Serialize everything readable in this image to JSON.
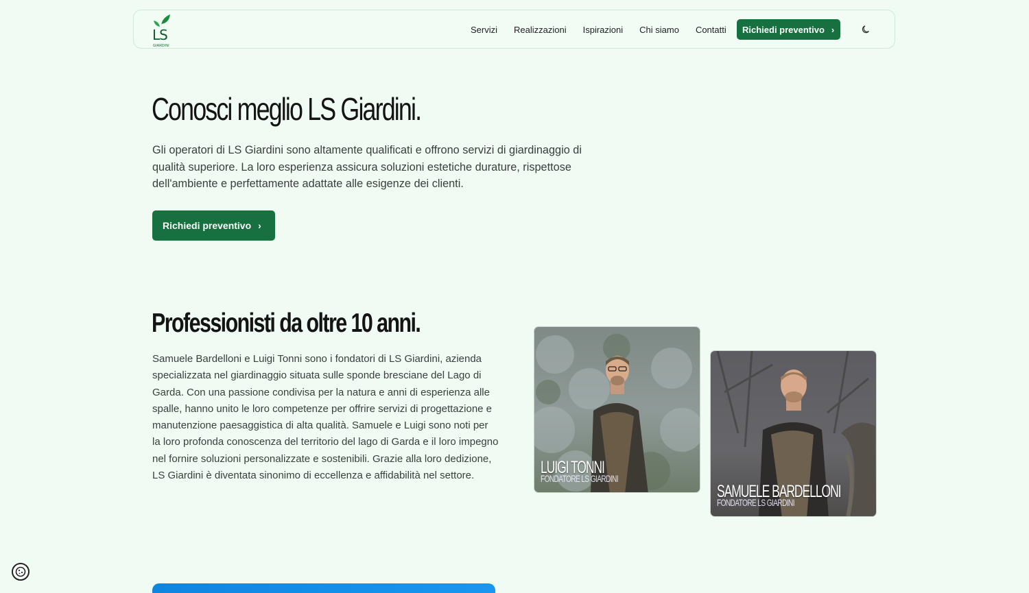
{
  "brand": {
    "logo_text": "LS",
    "logo_sub": "GIARDINI",
    "accent": "#16703f"
  },
  "nav": {
    "items": [
      "Servizi",
      "Realizzazioni",
      "Ispirazioni",
      "Chi siamo",
      "Contatti"
    ],
    "cta_label": "Richiedi preventivo",
    "theme_icon": "moon-icon"
  },
  "hero": {
    "title": "Conosci meglio LS Giardini.",
    "text": "Gli operatori di LS Giardini sono altamente qualificati e offrono servizi di giardinaggio di qualità superiore. La loro esperienza assicura soluzioni estetiche durature, rispettose dell'ambiente e perfettamente adattate alle esigenze dei clienti.",
    "cta_label": "Richiedi preventivo"
  },
  "about": {
    "title": "Professionisti da oltre 10 anni.",
    "text": "Samuele Bardelloni e Luigi Tonni sono i fondatori di LS Giardini, azienda specializzata nel giardinaggio situata sulle sponde bresciane del Lago di Garda. Con una passione condivisa per la natura e anni di esperienza alle spalle, hanno unito le loro competenze per offrire servizi di progettazione e manutenzione paesaggistica di alta qualità. Samuele e Luigi sono noti per la loro profonda conoscenza del territorio del lago di Garda e il loro impegno nel fornire soluzioni personalizzate e sostenibili. Grazie alla loro dedizione, LS Giardini è diventata sinonimo di eccellenza e affidabilità nel settore."
  },
  "founders": [
    {
      "name": "LUIGI TONNI",
      "role": "FONDATORE LS GIARDINI"
    },
    {
      "name": "SAMUELE BARDELLONI",
      "role": "FONDATORE LS GIARDINI"
    }
  ]
}
